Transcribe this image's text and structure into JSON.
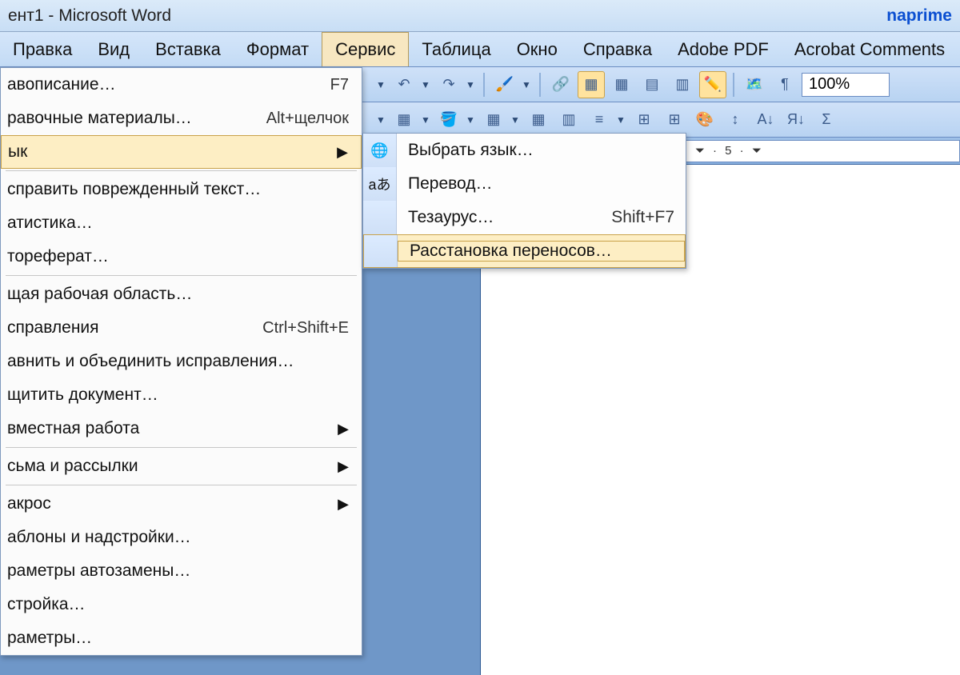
{
  "title": "ент1 - Microsoft Word",
  "brand": "naprime",
  "menubar": [
    "Правка",
    "Вид",
    "Вставка",
    "Формат",
    "Сервис",
    "Таблица",
    "Окно",
    "Справка",
    "Adobe PDF",
    "Acrobat Comments"
  ],
  "menubar_open_index": 4,
  "zoom": "100%",
  "ruler_text": "· 1 · ⏷ · 2 · ⏷ · 3 · ⏷ · 4 · ⏷ · 5 · ⏷",
  "service_menu": [
    {
      "label": "авописание…",
      "shortcut": "F7"
    },
    {
      "label": "равочные материалы…",
      "shortcut": "Alt+щелчок"
    },
    {
      "label": "ык",
      "submenu": true,
      "hover": true
    },
    {
      "sep": true
    },
    {
      "label": "справить поврежденный текст…"
    },
    {
      "label": "атистика…"
    },
    {
      "label": "тореферат…"
    },
    {
      "sep": true
    },
    {
      "label": "щая рабочая область…"
    },
    {
      "label": "справления",
      "shortcut": "Ctrl+Shift+E"
    },
    {
      "label": "авнить и объединить исправления…"
    },
    {
      "label": "щитить документ…"
    },
    {
      "label": "вместная работа",
      "submenu": true
    },
    {
      "sep": true
    },
    {
      "label": "сьма и рассылки",
      "submenu": true
    },
    {
      "sep": true
    },
    {
      "label": "акрос",
      "submenu": true
    },
    {
      "label": "аблоны и надстройки…"
    },
    {
      "label": "раметры автозамены…"
    },
    {
      "label": "стройка…"
    },
    {
      "label": "раметры…"
    }
  ],
  "lang_menu": [
    {
      "icon": "🌐",
      "label": "Выбрать язык…"
    },
    {
      "icon": "aあ",
      "label": "Перевод…"
    },
    {
      "icon": "",
      "label": "Тезаурус…",
      "shortcut": "Shift+F7"
    },
    {
      "icon": "",
      "label": "Расстановка переносов…",
      "hover": true
    }
  ]
}
